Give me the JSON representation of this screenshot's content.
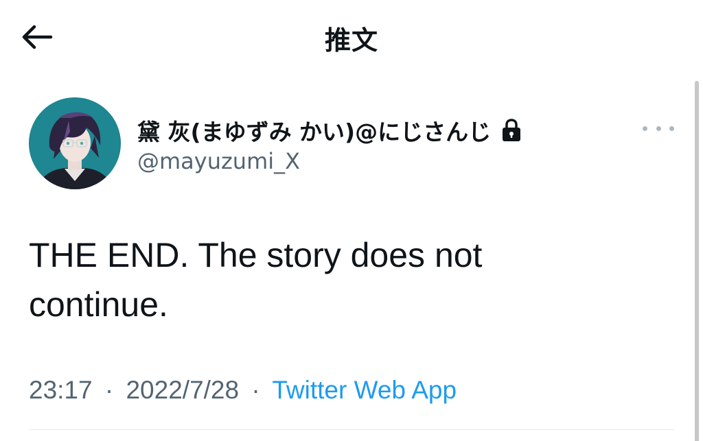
{
  "header": {
    "title": "推文",
    "back_icon": "arrow-left-icon"
  },
  "tweet": {
    "author": {
      "display_name": "黛 灰(まゆずみ かい)@にじさんじ",
      "handle": "@mayuzumi_X",
      "protected_icon": "lock-icon"
    },
    "text_line1": "THE END. The story does not",
    "text_line2": "continue.",
    "time": "23:17",
    "date": "2022/7/28",
    "separator": "·",
    "source": "Twitter Web App"
  },
  "colors": {
    "accent": "#1d9bf0",
    "secondary_text": "#536471",
    "primary_text": "#0f1419"
  }
}
